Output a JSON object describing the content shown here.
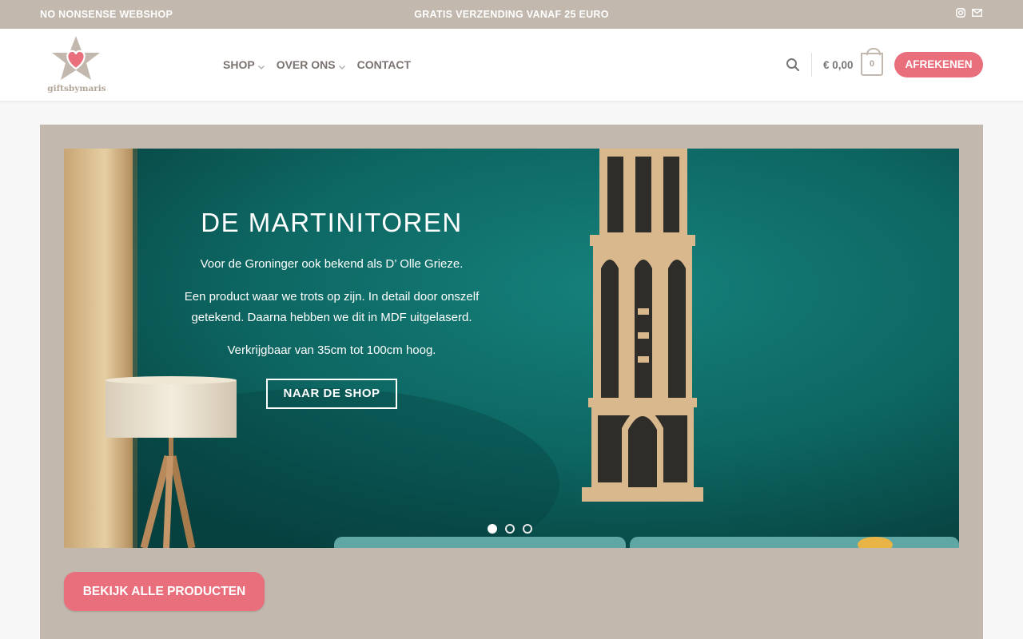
{
  "topbar": {
    "left_text": "NO NONSENSE WEBSHOP",
    "center_text": "GRATIS VERZENDING VANAF 25 EURO",
    "icons": [
      "instagram-icon",
      "envelope-icon"
    ]
  },
  "header": {
    "logo_text": "giftsbymaris",
    "nav": [
      {
        "label": "SHOP",
        "has_dropdown": true
      },
      {
        "label": "OVER ONS",
        "has_dropdown": true
      },
      {
        "label": "CONTACT",
        "has_dropdown": false
      }
    ],
    "cart_total": "€ 0,00",
    "cart_count": "0",
    "checkout_label": "AFREKENEN"
  },
  "hero": {
    "title": "DE MARTINITOREN",
    "paragraphs": [
      "Voor de Groninger ook bekend als D’ Olle Grieze.",
      "Een product waar we trots op zijn. In detail door onszelf getekend. Daarna hebben we dit in MDF uitgelaserd.",
      "Verkrijgbaar van 35cm tot 100cm hoog."
    ],
    "button_label": "NAAR DE SHOP",
    "slide_count": 3,
    "active_slide": 1
  },
  "products_button": "BEKIJK ALLE PRODUCTEN",
  "colors": {
    "accent": "#ea6f7c",
    "taupe": "#c2b8ae",
    "teal": "#0c5a57"
  }
}
